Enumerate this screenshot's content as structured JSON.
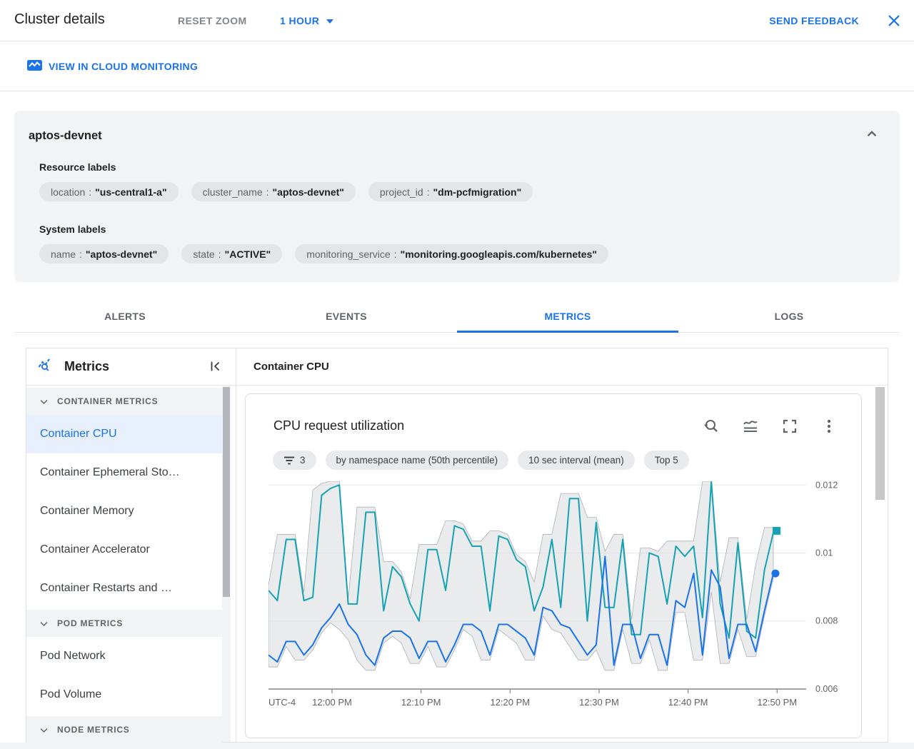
{
  "colors": {
    "accent": "#1A73E8",
    "teal_series": "#16A2B3",
    "blue_series": "#1A73E8",
    "band_fill": "#D9DBDD",
    "band_stroke": "#9AA0A6"
  },
  "header": {
    "title": "Cluster details",
    "reset_zoom_label": "RESET ZOOM",
    "time_range_label": "1 HOUR",
    "send_feedback_label": "SEND FEEDBACK"
  },
  "toolbar": {
    "monitoring_link_label": "VIEW IN CLOUD MONITORING"
  },
  "summary": {
    "title": "aptos-devnet",
    "chip_separator": ":",
    "resource_labels_heading": "Resource labels",
    "resource_labels": [
      {
        "key": "location",
        "value": "\"us-central1-a\""
      },
      {
        "key": "cluster_name",
        "value": "\"aptos-devnet\""
      },
      {
        "key": "project_id",
        "value": "\"dm-pcfmigration\""
      }
    ],
    "system_labels_heading": "System labels",
    "system_labels": [
      {
        "key": "name",
        "value": "\"aptos-devnet\""
      },
      {
        "key": "state",
        "value": "\"ACTIVE\""
      },
      {
        "key": "monitoring_service",
        "value": "\"monitoring.googleapis.com/kubernetes\""
      }
    ]
  },
  "tabs": [
    {
      "label": "ALERTS"
    },
    {
      "label": "EVENTS"
    },
    {
      "label": "METRICS"
    },
    {
      "label": "LOGS"
    }
  ],
  "active_tab": "METRICS",
  "sidebar": {
    "title": "Metrics",
    "sections": [
      {
        "header": "CONTAINER METRICS",
        "items": [
          {
            "label": "Container CPU",
            "selected": true
          },
          {
            "label": "Container Ephemeral Sto…"
          },
          {
            "label": "Container Memory"
          },
          {
            "label": "Container Accelerator"
          },
          {
            "label": "Container Restarts and …"
          }
        ]
      },
      {
        "header": "POD METRICS",
        "items": [
          {
            "label": "Pod Network"
          },
          {
            "label": "Pod Volume"
          }
        ]
      },
      {
        "header": "NODE METRICS",
        "items": []
      }
    ]
  },
  "main": {
    "header": "Container CPU"
  },
  "chart_card": {
    "title": "CPU request utilization",
    "filter_count": "3",
    "chips": [
      "by namespace name (50th percentile)",
      "10 sec interval (mean)",
      "Top 5"
    ],
    "icon_names": [
      "zoom-history-icon",
      "chart-type-icon",
      "fullscreen-icon",
      "more-options-icon"
    ]
  },
  "chart_data": {
    "type": "line",
    "title": "CPU request utilization",
    "x_prefix_label": "UTC-4",
    "x_ticks": [
      "12:00 PM",
      "12:10 PM",
      "12:20 PM",
      "12:30 PM",
      "12:40 PM",
      "12:50 PM"
    ],
    "y_ticks": [
      {
        "label": "0.012",
        "value": 0.012
      },
      {
        "label": "0.01",
        "value": 0.01
      },
      {
        "label": "0.008",
        "value": 0.008
      },
      {
        "label": "0.006",
        "value": 0.006
      }
    ],
    "y_range": [
      0.006,
      0.01211
    ],
    "grid": true,
    "legend": "none",
    "band": {
      "fill": "#D9DBDD",
      "stroke": "#9AA0A6",
      "opacity": 0.55,
      "offset": 0.00015
    },
    "series": [
      {
        "id": "teal",
        "color": "#16A2B3",
        "marker": "square",
        "values": [
          0.0089,
          0.0086,
          0.0104,
          0.0104,
          0.0086,
          0.0087,
          0.0117,
          0.0119,
          0.012,
          0.0085,
          0.0085,
          0.0112,
          0.0112,
          0.0083,
          0.0096,
          0.0093,
          0.0085,
          0.008,
          0.0101,
          0.0101,
          0.0089,
          0.0108,
          0.0107,
          0.0102,
          0.0102,
          0.0083,
          0.0105,
          0.0104,
          0.0098,
          0.0096,
          0.0083,
          0.009,
          0.0104,
          0.0084,
          0.0116,
          0.0116,
          0.008,
          0.0109,
          0.0084,
          0.0084,
          0.0104,
          0.0076,
          0.0076,
          0.01,
          0.0099,
          0.0085,
          0.0102,
          0.0099,
          0.0102,
          0.0081,
          0.0121,
          0.0085,
          0.0075,
          0.0103,
          0.0077,
          0.0075,
          0.0095,
          0.0106
        ]
      },
      {
        "id": "blue",
        "color": "#1A73E8",
        "marker": "circle",
        "values": [
          0.007,
          0.0068,
          0.0074,
          0.0074,
          0.007,
          0.0073,
          0.0078,
          0.0081,
          0.0085,
          0.0079,
          0.0076,
          0.007,
          0.0067,
          0.0075,
          0.0077,
          0.0077,
          0.0075,
          0.0069,
          0.0074,
          0.0074,
          0.0068,
          0.0073,
          0.0079,
          0.0079,
          0.0077,
          0.007,
          0.0079,
          0.0079,
          0.0077,
          0.0075,
          0.007,
          0.0084,
          0.0083,
          0.0079,
          0.0078,
          0.0074,
          0.007,
          0.0073,
          0.0099,
          0.0067,
          0.0079,
          0.0079,
          0.0069,
          0.0076,
          0.0076,
          0.0067,
          0.0086,
          0.0084,
          0.0094,
          0.007,
          0.0095,
          0.009,
          0.0069,
          0.0079,
          0.0079,
          0.0071,
          0.0083,
          0.0094
        ]
      }
    ]
  }
}
